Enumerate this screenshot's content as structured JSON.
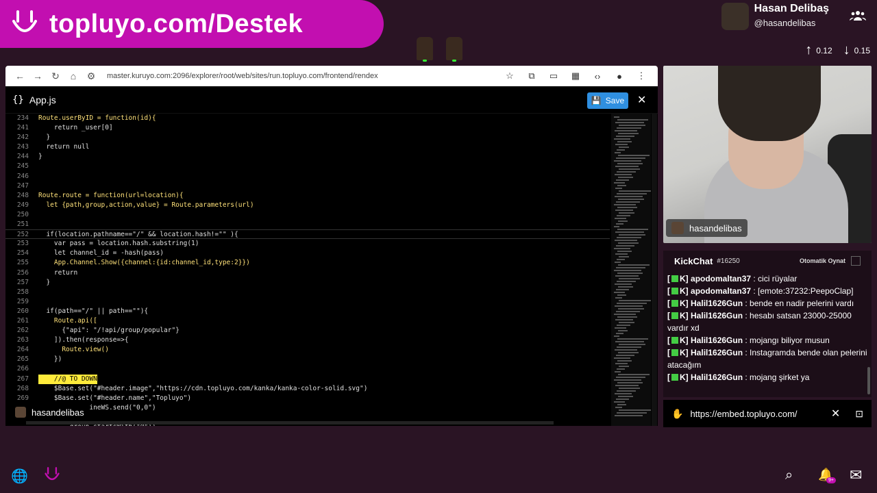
{
  "banner": {
    "title": "topluyo.com/Destek"
  },
  "user": {
    "name": "Hasan Delibaş",
    "handle": "@hasandelibas"
  },
  "stats": {
    "up": "0.12",
    "down": "0.15"
  },
  "browser": {
    "url": "master.kuruyo.com:2096/explorer/root/web/sites/run.topluyo.com/frontend/rendex",
    "file_name": "App.js",
    "save_label": "Save"
  },
  "editor": {
    "lines": [
      {
        "n": "234",
        "code": "Route.userByID = function(id){"
      },
      {
        "n": "241",
        "code": "    return _user[0]"
      },
      {
        "n": "242",
        "code": "  }"
      },
      {
        "n": "243",
        "code": "  return null"
      },
      {
        "n": "244",
        "code": "}"
      },
      {
        "n": "245",
        "code": ""
      },
      {
        "n": "246",
        "code": ""
      },
      {
        "n": "247",
        "code": ""
      },
      {
        "n": "248",
        "code": "Route.route = function(url=location){"
      },
      {
        "n": "249",
        "code": "  let {path,group,action,value} = Route.parameters(url)"
      },
      {
        "n": "250",
        "code": ""
      },
      {
        "n": "251",
        "code": ""
      },
      {
        "n": "252",
        "code": "  if(location.pathname==\"/\" && location.hash!=\"\" ){"
      },
      {
        "n": "253",
        "code": "    var pass = location.hash.substring(1)"
      },
      {
        "n": "254",
        "code": "    let channel_id = -hash(pass)"
      },
      {
        "n": "255",
        "code": "    App.Channel.Show({channel:{id:channel_id,type:2}})"
      },
      {
        "n": "256",
        "code": "    return"
      },
      {
        "n": "257",
        "code": "  }"
      },
      {
        "n": "258",
        "code": ""
      },
      {
        "n": "259",
        "code": ""
      },
      {
        "n": "260",
        "code": "  if(path==\"/\" || path==\"\"){"
      },
      {
        "n": "261",
        "code": "    Route.api(["
      },
      {
        "n": "262",
        "code": "      {\"api\": \"/!api/group/popular\"}"
      },
      {
        "n": "263",
        "code": "    ]).then(response=>{"
      },
      {
        "n": "264",
        "code": "      Route.view()"
      },
      {
        "n": "265",
        "code": "    })"
      },
      {
        "n": "266",
        "code": ""
      },
      {
        "n": "267",
        "code": "    //@ TO DOWN"
      },
      {
        "n": "268",
        "code": "    $Base.set(\"#header.image\",\"https://cdn.topluyo.com/kanka/kanka-color-solid.svg\")"
      },
      {
        "n": "269",
        "code": "    $Base.set(\"#header.name\",\"Topluyo\")"
      },
      {
        "n": "",
        "code": "             ineWS.send(\"0,0\")"
      },
      {
        "n": "",
        "code": ""
      },
      {
        "n": "",
        "code": "        group.startsWith(\"@\"))"
      }
    ]
  },
  "overlay_name": "hasandelibas",
  "webcam_name": "hasandelibas",
  "chat": {
    "title": "KickChat",
    "count": "#16250",
    "auto_play": "Otomatik Oynat",
    "messages": [
      {
        "badge": "K]",
        "user": "apodomaltan37",
        "text": " : cici rüyalar"
      },
      {
        "badge": "K]",
        "user": "apodomaltan37",
        "text": " : [emote:37232:PeepoClap]"
      },
      {
        "badge": "K]",
        "user": "Halil1626Gun",
        "text": " : bende en nadir pelerini vardı"
      },
      {
        "badge": "K]",
        "user": "Halil1626Gun",
        "text": " : hesabı satsan 23000-25000 vardır xd"
      },
      {
        "badge": "K]",
        "user": "Halil1626Gun",
        "text": " : mojangı biliyor musun"
      },
      {
        "badge": "K]",
        "user": "Halil1626Gun",
        "text": " : Instagramda bende olan pelerini atacağım"
      },
      {
        "badge": "K]",
        "user": "Halil1626Gun",
        "text": " : mojang şirket ya"
      }
    ]
  },
  "embed_url": "https://embed.topluyo.com/",
  "notif_badge": "9+",
  "colors": {
    "brand": "#c20fb0",
    "background": "#2a1424",
    "save": "#2f8fe0"
  }
}
